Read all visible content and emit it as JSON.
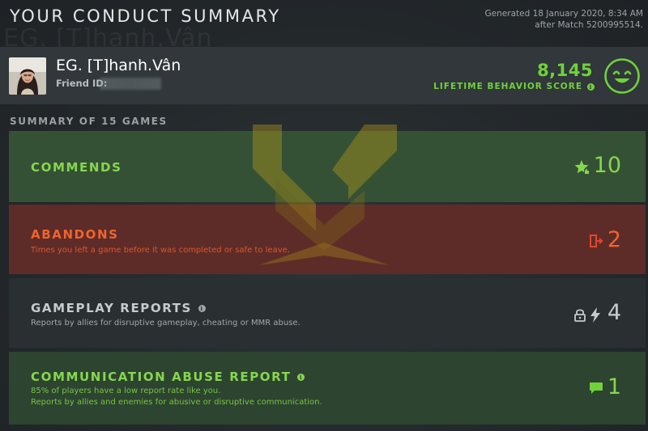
{
  "page": {
    "title": "YOUR CONDUCT SUMMARY",
    "generated_line1": "Generated 18 January 2020, 8:34 AM",
    "generated_line2": "after Match 5200995514."
  },
  "player": {
    "name": "EG. [T]hanh.Vân",
    "name_watermark": "EG. [T]hanh.Vân",
    "friend_id_label": "Friend ID:",
    "score": "8,145",
    "score_label": "LIFETIME BEHAVIOR SCORE",
    "score_icon": "smiley-face-icon",
    "accent_color": "#6fd23a"
  },
  "summary": {
    "header": "SUMMARY OF 15 GAMES",
    "cards": [
      {
        "id": "commends",
        "title": "COMMENDS",
        "count": "10",
        "icon": "star-thumbs-up-icon",
        "color": "#85d84c"
      },
      {
        "id": "abandons",
        "title": "ABANDONS",
        "description": "Times you left a game before it was completed or safe to leave.",
        "count": "2",
        "icon": "exit-door-icon",
        "color": "#f0642f"
      },
      {
        "id": "gameplay-reports",
        "title": "GAMEPLAY REPORTS",
        "description": "Reports by allies for disruptive gameplay, cheating or MMR abuse.",
        "count": "4",
        "icons": [
          "lock-icon",
          "lightning-icon"
        ],
        "color": "#c6cbcd"
      },
      {
        "id": "communication-abuse",
        "title": "COMMUNICATION ABUSE REPORT",
        "description_line1": "85% of players have a low report rate like you.",
        "description_line2": "Reports by allies and enemies for abusive or disruptive communication.",
        "count": "1",
        "icon": "chat-bubble-icon",
        "color": "#85d84c"
      }
    ]
  }
}
